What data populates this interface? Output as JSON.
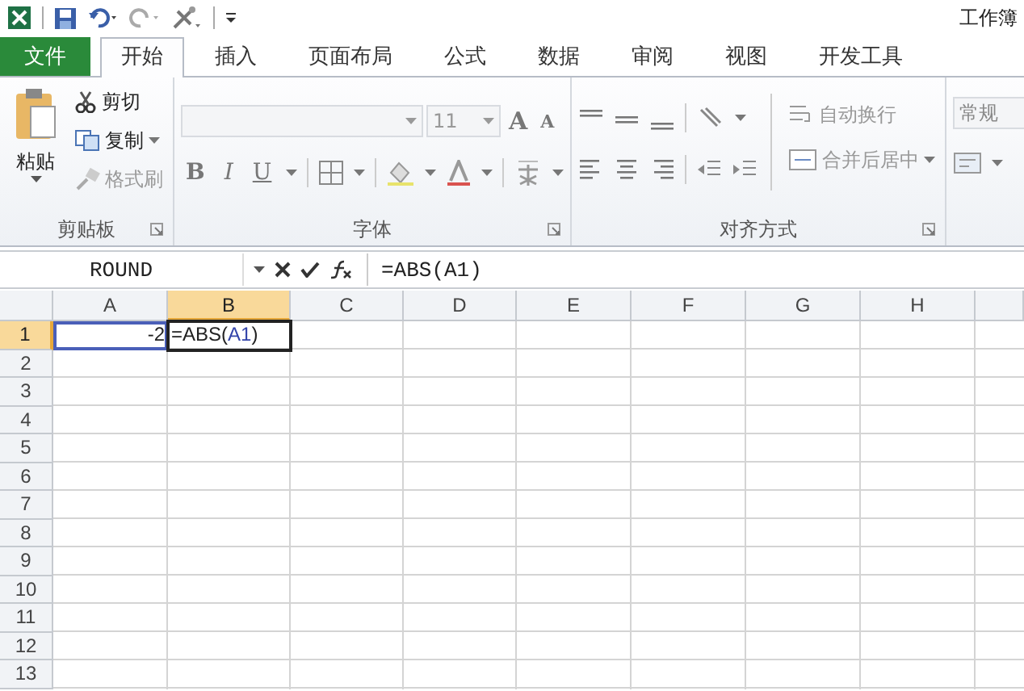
{
  "window": {
    "title": "工作簿"
  },
  "tabs": [
    {
      "label": "文件",
      "kind": "file",
      "selected": false
    },
    {
      "label": "开始",
      "kind": "tab",
      "selected": true
    },
    {
      "label": "插入",
      "kind": "tab",
      "selected": false
    },
    {
      "label": "页面布局",
      "kind": "tab",
      "selected": false
    },
    {
      "label": "公式",
      "kind": "tab",
      "selected": false
    },
    {
      "label": "数据",
      "kind": "tab",
      "selected": false
    },
    {
      "label": "审阅",
      "kind": "tab",
      "selected": false
    },
    {
      "label": "视图",
      "kind": "tab",
      "selected": false
    },
    {
      "label": "开发工具",
      "kind": "tab",
      "selected": false
    }
  ],
  "clipboard": {
    "title": "剪贴板",
    "paste": "粘贴",
    "cut": {
      "label": "剪切",
      "disabled": false
    },
    "copy": {
      "label": "复制",
      "disabled": false
    },
    "format_painter": {
      "label": "格式刷",
      "disabled": true
    }
  },
  "font": {
    "title": "字体",
    "size": "11",
    "grow": "A",
    "shrink": "A",
    "bold": "B",
    "italic": "I",
    "underline": "U"
  },
  "alignment": {
    "title": "对齐方式",
    "wrap": {
      "label": "自动换行",
      "disabled": true
    },
    "merge": {
      "label": "合并后居中",
      "disabled": true
    }
  },
  "number": {
    "format": "常规"
  },
  "formula_bar": {
    "name_box": "ROUND",
    "formula": "=ABS(A1)"
  },
  "columns": [
    {
      "label": "A",
      "selected": false
    },
    {
      "label": "B",
      "selected": true
    },
    {
      "label": "C",
      "selected": false
    },
    {
      "label": "D",
      "selected": false
    },
    {
      "label": "E",
      "selected": false
    },
    {
      "label": "F",
      "selected": false
    },
    {
      "label": "G",
      "selected": false
    },
    {
      "label": "H",
      "selected": false
    }
  ],
  "rows": [
    {
      "label": "1",
      "selected": true,
      "cells": [
        {
          "kind": "number",
          "text": "-2",
          "referenced": true,
          "selected": false
        },
        {
          "kind": "formula",
          "parts": [
            {
              "text": "=ABS("
            },
            {
              "text": "A1",
              "kind": "ref"
            },
            {
              "text": ")"
            }
          ],
          "referenced": false,
          "selected": true
        }
      ]
    },
    {
      "label": "2",
      "selected": false
    },
    {
      "label": "3",
      "selected": false
    },
    {
      "label": "4",
      "selected": false
    },
    {
      "label": "5",
      "selected": false
    },
    {
      "label": "6",
      "selected": false
    },
    {
      "label": "7",
      "selected": false
    },
    {
      "label": "8",
      "selected": false
    },
    {
      "label": "9",
      "selected": false
    },
    {
      "label": "10",
      "selected": false
    },
    {
      "label": "11",
      "selected": false
    },
    {
      "label": "12",
      "selected": false
    },
    {
      "label": "13",
      "selected": false
    }
  ]
}
